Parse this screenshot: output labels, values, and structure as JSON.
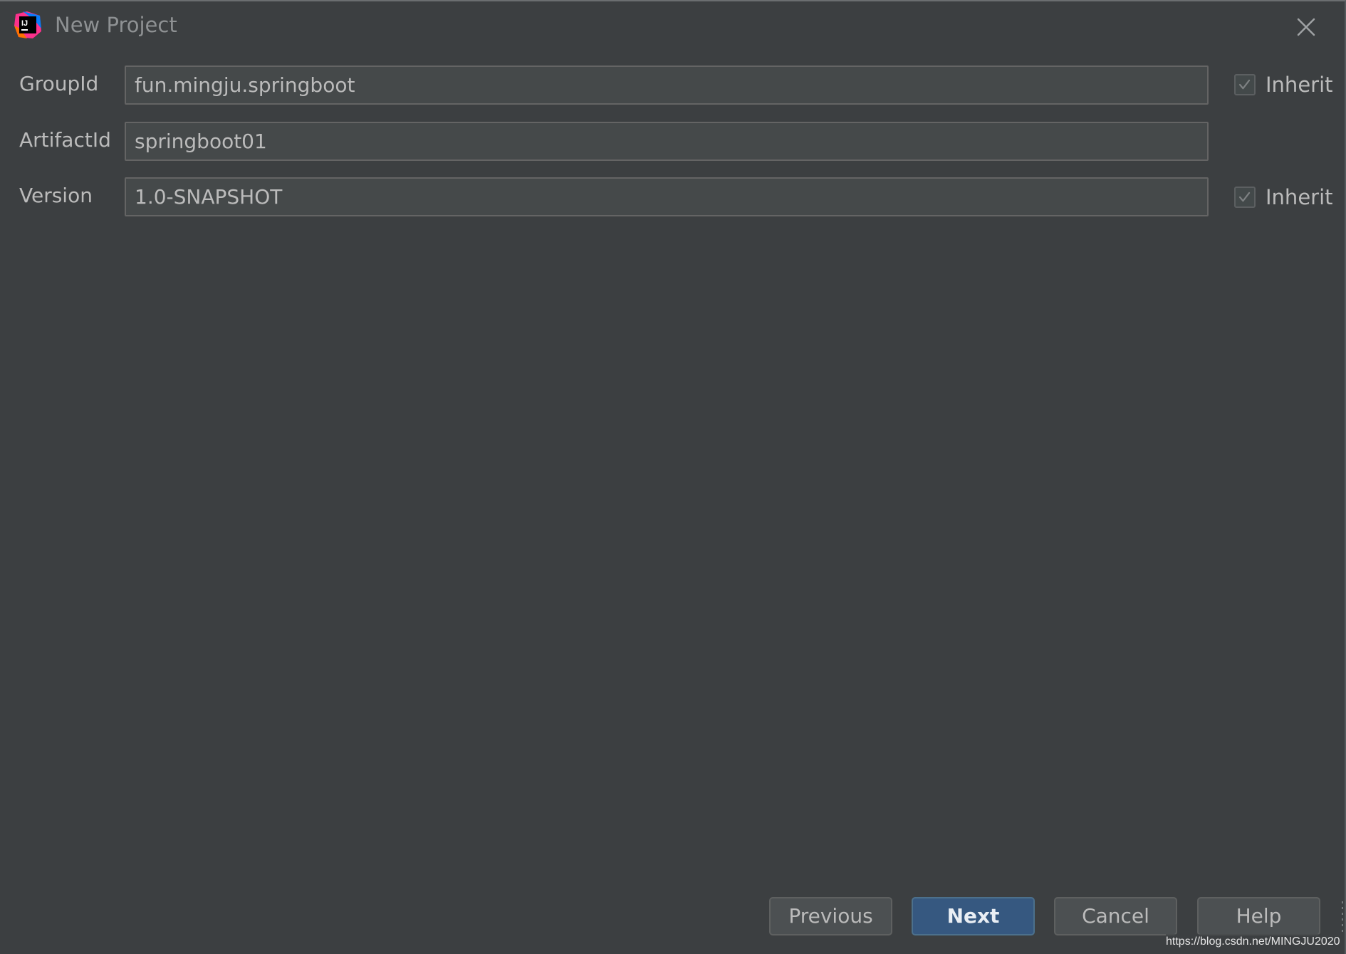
{
  "window": {
    "title": "New Project",
    "close_icon": "close-icon",
    "app_icon": "intellij-idea-icon",
    "app_icon_text": "IJ"
  },
  "form": {
    "group_id": {
      "label": "GroupId",
      "value": "fun.mingju.springboot",
      "inherit_label": "Inherit",
      "inherit_checked": true
    },
    "artifact_id": {
      "label": "ArtifactId",
      "value": "springboot01"
    },
    "version": {
      "label": "Version",
      "value": "1.0-SNAPSHOT",
      "inherit_label": "Inherit",
      "inherit_checked": true
    }
  },
  "buttons": {
    "previous": "Previous",
    "next": "Next",
    "cancel": "Cancel",
    "help": "Help"
  },
  "watermark": "https://blog.csdn.net/MINGJU2020",
  "colors": {
    "background": "#3c3f41",
    "field_background": "#45494a",
    "primary_button": "#365880",
    "text": "#bbbbbb"
  }
}
